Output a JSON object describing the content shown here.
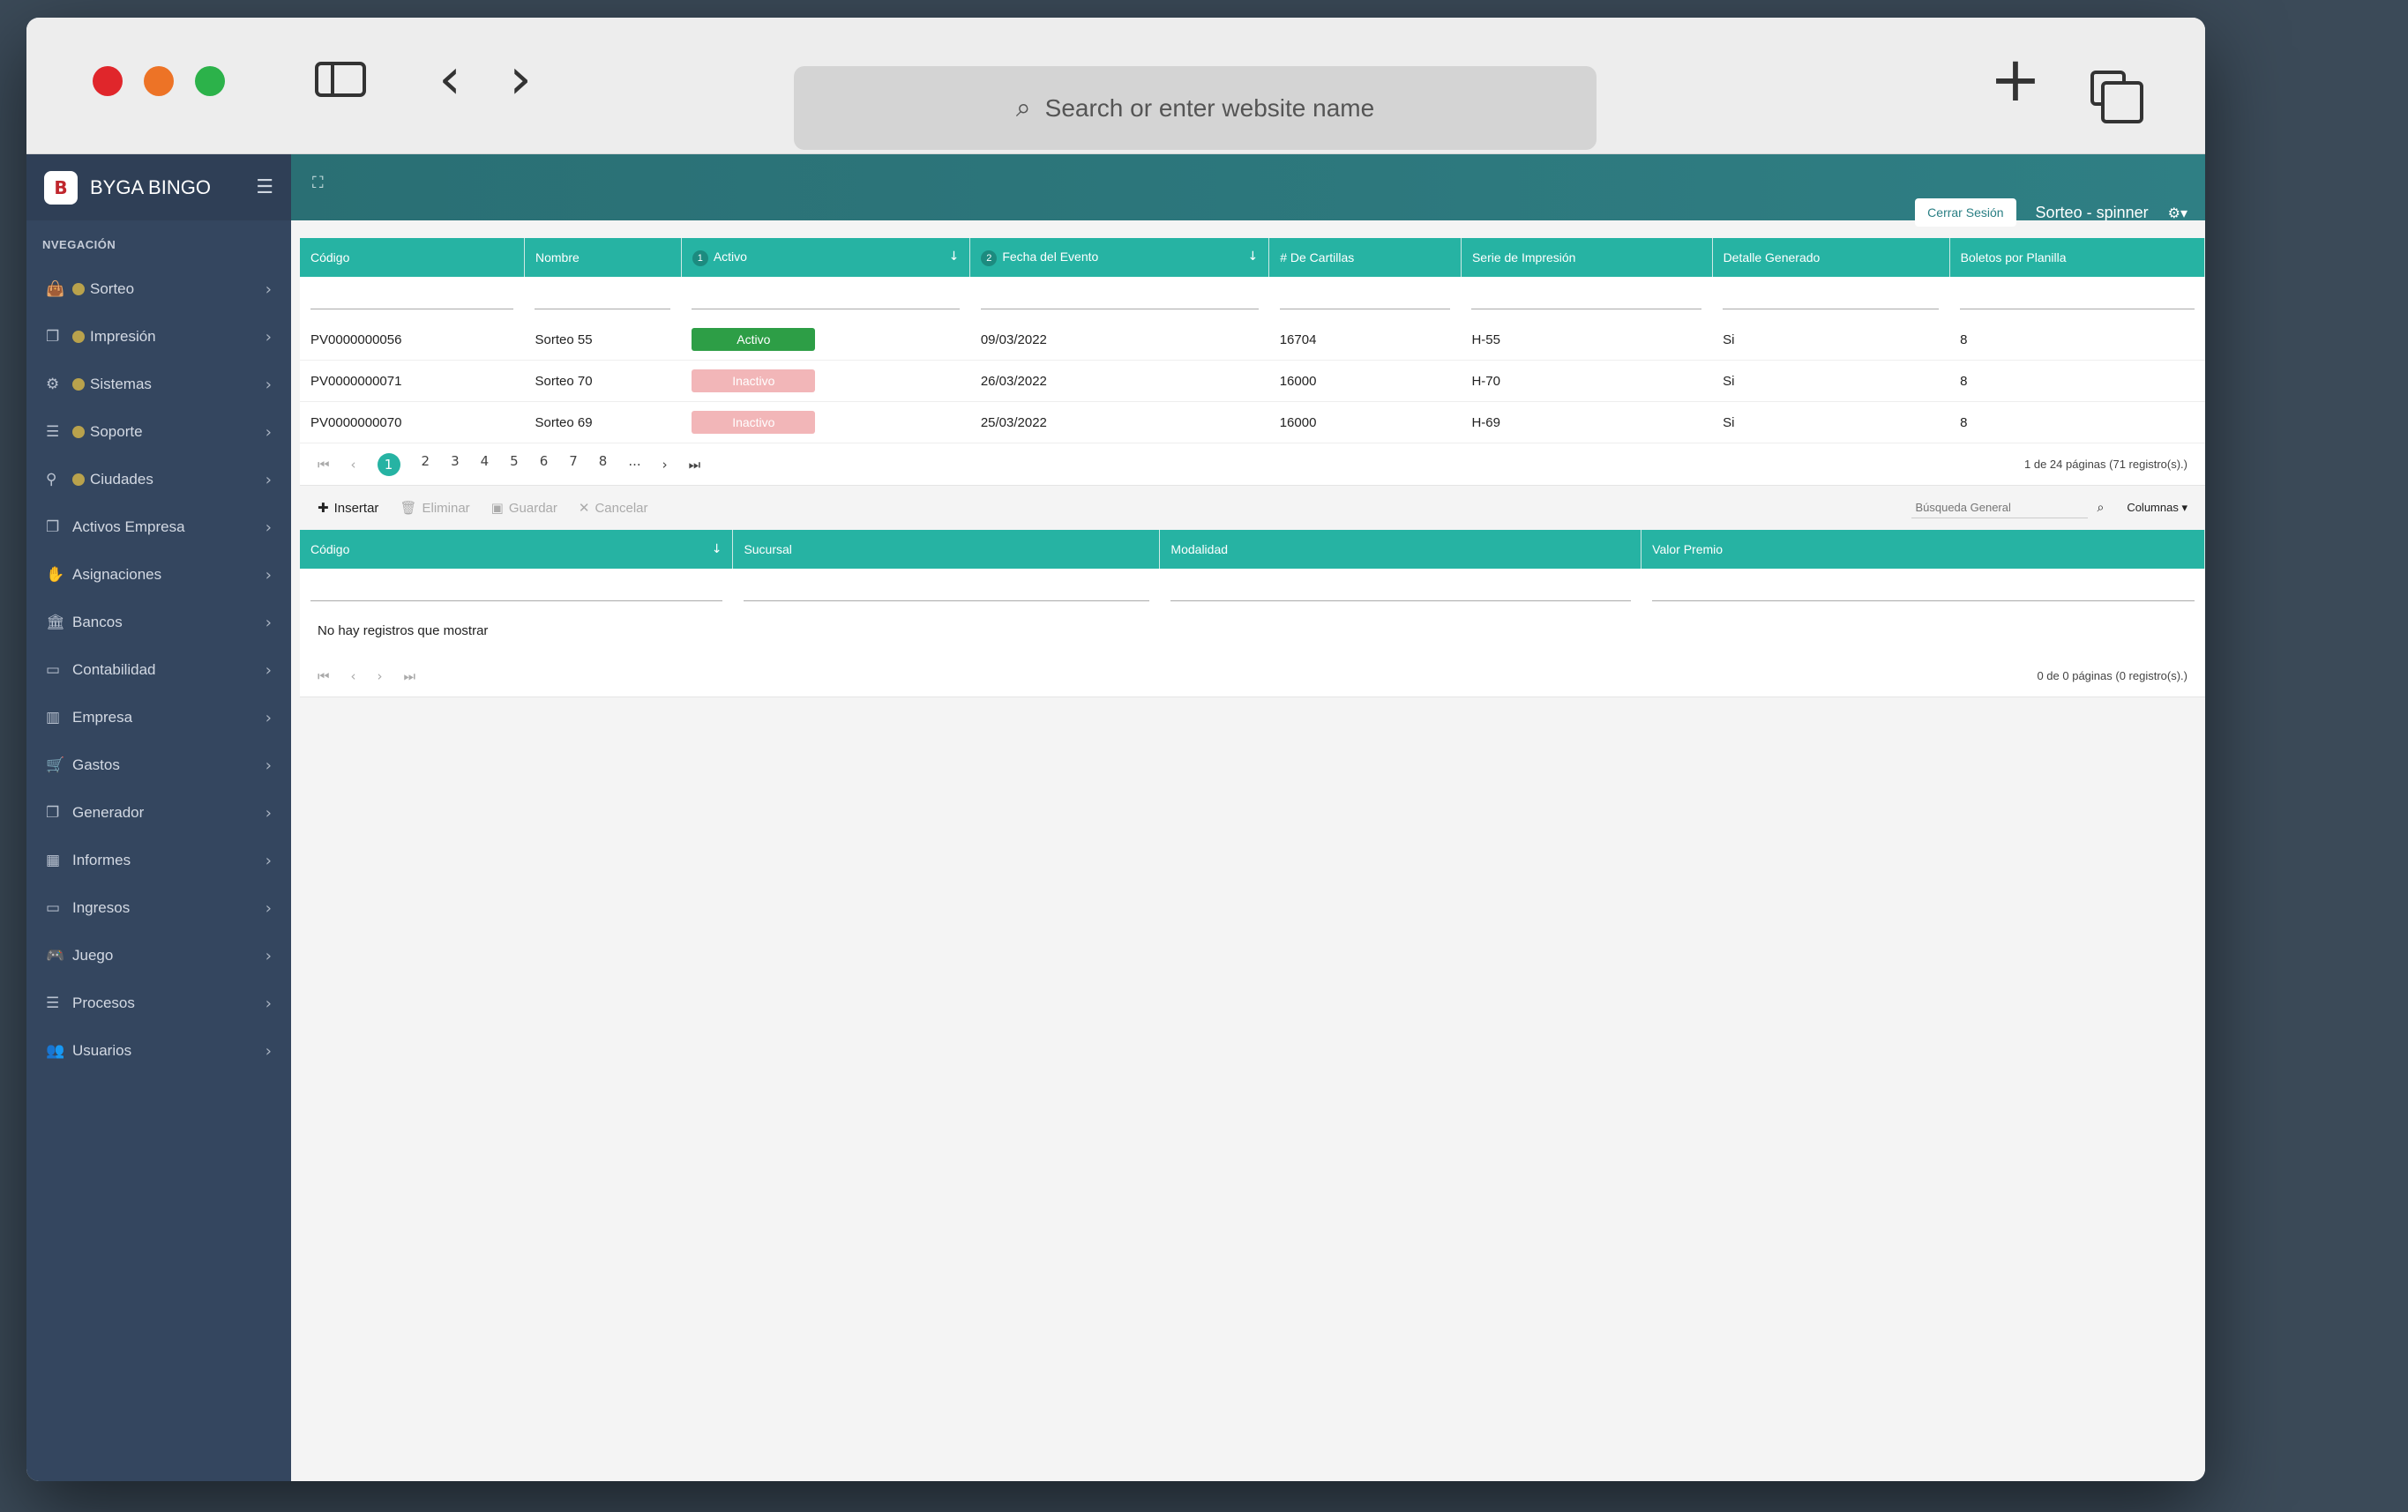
{
  "browser": {
    "address_placeholder": "Search or enter website name"
  },
  "app": {
    "brand": "BYGA BINGO",
    "nav_title": "NVEGACIÓN",
    "nav_items": [
      {
        "label": "Sorteo",
        "icon": "bag-icon",
        "badge": true
      },
      {
        "label": "Impresión",
        "icon": "copy-icon",
        "badge": true
      },
      {
        "label": "Sistemas",
        "icon": "cogs-icon",
        "badge": true
      },
      {
        "label": "Soporte",
        "icon": "list-icon",
        "badge": true
      },
      {
        "label": "Ciudades",
        "icon": "map-pin-icon",
        "badge": true
      },
      {
        "label": "Activos Empresa",
        "icon": "copy-icon",
        "badge": false
      },
      {
        "label": "Asignaciones",
        "icon": "handshake-icon",
        "badge": false
      },
      {
        "label": "Bancos",
        "icon": "bank-icon",
        "badge": false
      },
      {
        "label": "Contabilidad",
        "icon": "card-icon",
        "badge": false
      },
      {
        "label": "Empresa",
        "icon": "building-icon",
        "badge": false
      },
      {
        "label": "Gastos",
        "icon": "cart-icon",
        "badge": false
      },
      {
        "label": "Generador",
        "icon": "copy-icon",
        "badge": false
      },
      {
        "label": "Informes",
        "icon": "table-icon",
        "badge": false
      },
      {
        "label": "Ingresos",
        "icon": "card-icon",
        "badge": false
      },
      {
        "label": "Juego",
        "icon": "gamepad-icon",
        "badge": false
      },
      {
        "label": "Procesos",
        "icon": "list-icon",
        "badge": false
      },
      {
        "label": "Usuarios",
        "icon": "users-icon",
        "badge": false
      }
    ],
    "logout": "Cerrar Sesión",
    "username": "Sorteo - spinner"
  },
  "grid1": {
    "columns": [
      "Código",
      "Nombre",
      "Activo",
      "Fecha del Evento",
      "# De Cartillas",
      "Serie de Impresión",
      "Detalle Generado",
      "Boletos por Planilla"
    ],
    "sort_badges": {
      "activo": "1",
      "fecha": "2"
    },
    "rows": [
      {
        "codigo": "PV0000000056",
        "nombre": "Sorteo 55",
        "activo": "Activo",
        "activo_on": true,
        "fecha": "09/03/2022",
        "cartillas": "16704",
        "serie": "H-55",
        "detalle": "Si",
        "boletos": "8"
      },
      {
        "codigo": "PV0000000071",
        "nombre": "Sorteo 70",
        "activo": "Inactivo",
        "activo_on": false,
        "fecha": "26/03/2022",
        "cartillas": "16000",
        "serie": "H-70",
        "detalle": "Si",
        "boletos": "8"
      },
      {
        "codigo": "PV0000000070",
        "nombre": "Sorteo 69",
        "activo": "Inactivo",
        "activo_on": false,
        "fecha": "25/03/2022",
        "cartillas": "16000",
        "serie": "H-69",
        "detalle": "Si",
        "boletos": "8"
      }
    ],
    "pages": [
      "1",
      "2",
      "3",
      "4",
      "5",
      "6",
      "7",
      "8",
      "..."
    ],
    "page_info": "1 de 24 páginas (71 registro(s).)"
  },
  "toolbar": {
    "insert": "Insertar",
    "delete": "Eliminar",
    "save": "Guardar",
    "cancel": "Cancelar",
    "search_placeholder": "Búsqueda General",
    "columns": "Columnas"
  },
  "grid2": {
    "columns": [
      "Código",
      "Sucursal",
      "Modalidad",
      "Valor Premio"
    ],
    "empty_message": "No hay registros que mostrar",
    "page_info": "0 de 0 páginas (0 registro(s).)"
  }
}
